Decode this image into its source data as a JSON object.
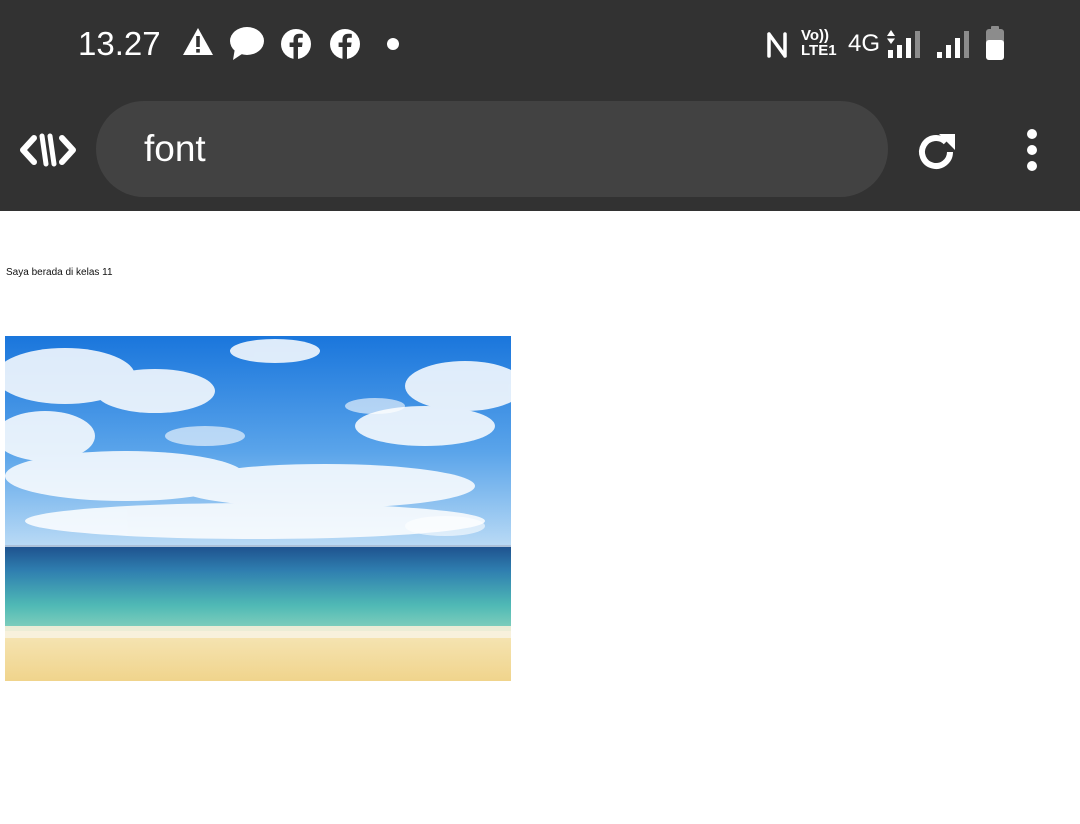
{
  "status_bar": {
    "time": "13.27",
    "left_icons": [
      "warning-icon",
      "message-icon",
      "facebook-icon",
      "facebook-icon",
      "dot-icon"
    ],
    "right_icons": [
      "nfc-icon",
      "volte-icon",
      "signal-icon",
      "signal-icon",
      "battery-icon"
    ],
    "volte_label_top": "Vo))",
    "volte_label_bottom": "LTE1",
    "network_type": "4G"
  },
  "browser": {
    "url_text": "font",
    "logo_icon": "app-logo-icon",
    "reload_icon": "reload-icon",
    "menu_icon": "more-vert-icon"
  },
  "page": {
    "paragraph": "Saya berada di kelas 11",
    "image_alt": "beach-photo"
  },
  "colors": {
    "chrome_bg": "#323232",
    "url_pill_bg": "#424242",
    "page_bg": "#ffffff",
    "sky_blue": "#1e7fe0",
    "sea_teal": "#4fb4b8",
    "sand": "#f2dc9a"
  }
}
